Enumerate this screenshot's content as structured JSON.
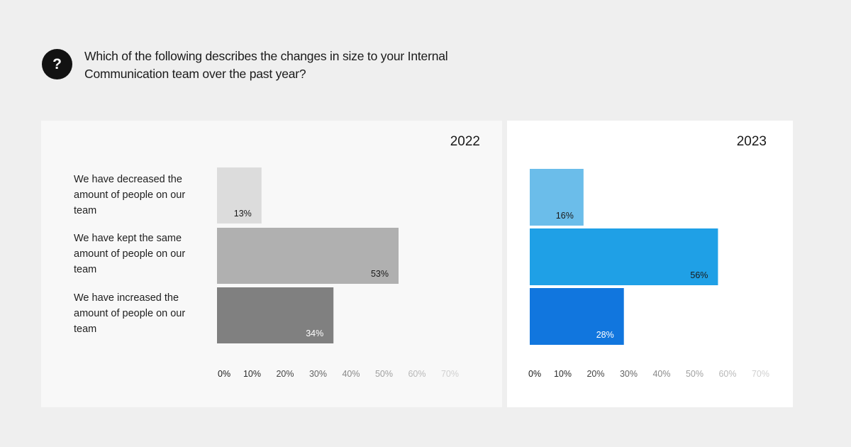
{
  "question": {
    "icon": "question-mark-icon",
    "icon_glyph": "?",
    "text": "Which of the following describes the changes in size to your Internal Communication team over the past year?"
  },
  "chart_data": [
    {
      "type": "bar",
      "orientation": "horizontal",
      "title": "2022",
      "categories": [
        "We have decreased the amount of people on our team",
        "We have kept the same amount of people on our team",
        "We have increased the amount of people on our team"
      ],
      "values": [
        13,
        53,
        34
      ],
      "value_labels": [
        "13%",
        "53%",
        "34%"
      ],
      "colors": [
        "#dcdcdc",
        "#b0b0b0",
        "#808080"
      ],
      "label_colors": [
        "#1a1a1a",
        "#1a1a1a",
        "#ffffff"
      ],
      "xticks": [
        "0%",
        "10%",
        "20%",
        "30%",
        "40%",
        "50%",
        "60%",
        "70%"
      ],
      "xlim": [
        0,
        70
      ],
      "xlabel": "",
      "ylabel": "",
      "grid": false
    },
    {
      "type": "bar",
      "orientation": "horizontal",
      "title": "2023",
      "categories": [
        "We have decreased the amount of people on our team",
        "We have kept the same amount of people on our team",
        "We have increased the amount of people on our team"
      ],
      "values": [
        16,
        56,
        28
      ],
      "value_labels": [
        "16%",
        "56%",
        "28%"
      ],
      "colors": [
        "#6bbdea",
        "#1fa0e6",
        "#1176de"
      ],
      "label_colors": [
        "#1a1a1a",
        "#1a1a1a",
        "#ffffff"
      ],
      "xticks": [
        "0%",
        "10%",
        "20%",
        "30%",
        "40%",
        "50%",
        "60%",
        "70%"
      ],
      "xlim": [
        0,
        70
      ],
      "xlabel": "",
      "ylabel": "",
      "grid": false
    }
  ],
  "tick_colors": [
    "#1a1a1a",
    "#2b2b2b",
    "#444444",
    "#666666",
    "#888888",
    "#a0a0a0",
    "#b8b8b8",
    "#d0d0d0"
  ]
}
